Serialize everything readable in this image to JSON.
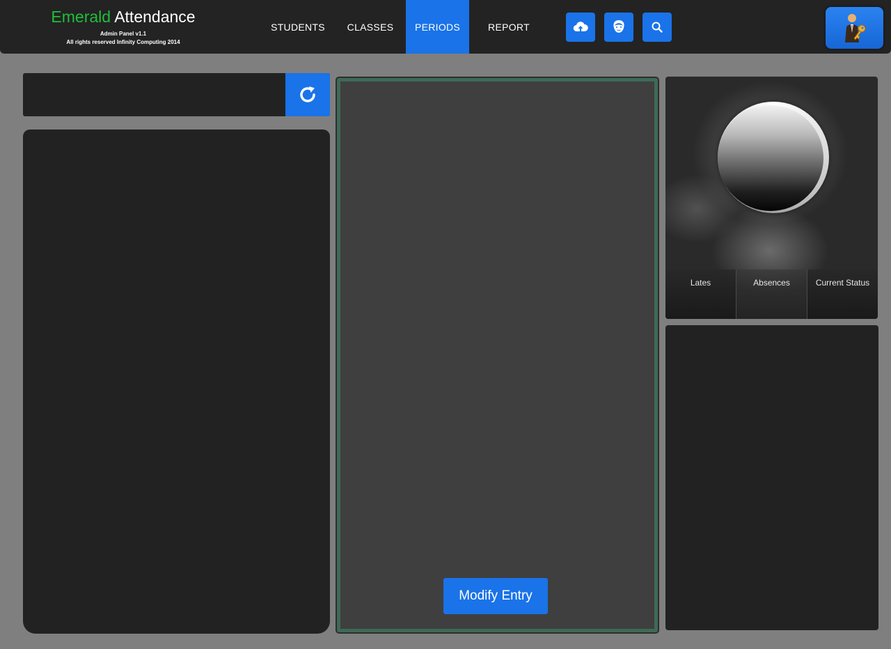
{
  "brand": {
    "title_accent": "Emerald",
    "title_rest": " Attendance",
    "subtitle_1": "Admin Panel v1.1",
    "subtitle_2": "All rights reserved Infinity Computing 2014",
    "accent_color": "#1fbf3a"
  },
  "nav": {
    "items": [
      {
        "label": "STUDENTS",
        "active": false
      },
      {
        "label": "CLASSES",
        "active": false
      },
      {
        "label": "PERIODS",
        "active": true
      },
      {
        "label": "REPORT",
        "active": false
      }
    ],
    "active_color": "#1a73e8"
  },
  "toolbar": {
    "icons": [
      "cloud-upload-icon",
      "face-icon",
      "search-icon"
    ],
    "avatar_icon": "admin-keys-icon"
  },
  "search": {
    "value": "",
    "placeholder": "",
    "refresh_icon": "refresh-icon"
  },
  "profile": {
    "stats": [
      {
        "label": "Lates"
      },
      {
        "label": "Absences"
      },
      {
        "label": "Current Status"
      }
    ]
  },
  "center": {
    "modify_label": "Modify Entry",
    "frame_color": "#3e6a57"
  },
  "colors": {
    "background": "#7f7f7f",
    "panel": "#222222",
    "button": "#1a73e8"
  }
}
